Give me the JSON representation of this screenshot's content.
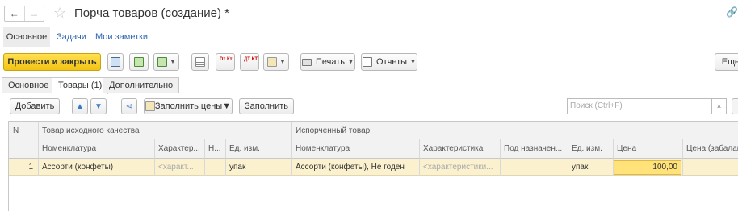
{
  "window": {
    "title": "Порча товаров (создание) *",
    "back": "←",
    "forward": "→",
    "star": "☆",
    "link": "🔗"
  },
  "sections": [
    "Основное",
    "Задачи",
    "Мои заметки"
  ],
  "toolbar": {
    "post_close": "Провести и закрыть",
    "print": "Печать",
    "reports": "Отчеты",
    "more": "Еще",
    "dtkt": "Dт Кт",
    "dtkt2": "ДТ КТ"
  },
  "tabs": [
    "Основное",
    "Товары (1)",
    "Дополнительно"
  ],
  "table_toolbar": {
    "add": "Добавить",
    "fill_prices": "Заполнить цены",
    "fill": "Заполнить",
    "search_placeholder": "Поиск (Ctrl+F)",
    "clear": "×"
  },
  "grid": {
    "group_headers": {
      "n": "N",
      "source": "Товар исходного качества",
      "spoiled": "Испорченный товар"
    },
    "columns": [
      "Номенклатура",
      "Характер...",
      "Н...",
      "Ед. изм.",
      "Номенклатура",
      "Характеристика",
      "Под назначен...",
      "Ед. изм.",
      "Цена",
      "Цена (забалан..."
    ],
    "rows": [
      {
        "n": "1",
        "item": "Ассорти (конфеты)",
        "char": "<характ...",
        "n2": "",
        "unit": "упак",
        "spoiled_item": "Ассорти (конфеты), Не годен",
        "spoiled_char": "<характеристики...",
        "purpose": "",
        "spoiled_unit": "упак",
        "price": "100,00",
        "offbalance_price": ""
      }
    ]
  },
  "colors": {
    "accent_yellow": "#f2c311",
    "link_blue": "#2b64b0",
    "selected_row": "#fbf1cf",
    "price_cell": "#ffe27a"
  }
}
